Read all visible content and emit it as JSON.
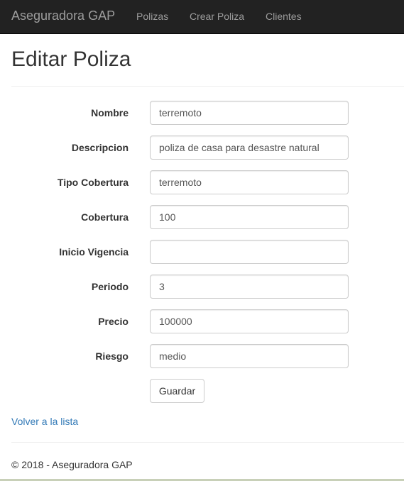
{
  "navbar": {
    "brand": "Aseguradora GAP",
    "links": [
      "Polizas",
      "Crear Poliza",
      "Clientes"
    ]
  },
  "page": {
    "title": "Editar Poliza"
  },
  "form": {
    "fields": [
      {
        "label": "Nombre",
        "value": "terremoto",
        "placeholder": ""
      },
      {
        "label": "Descripcion",
        "value": "poliza de casa para desastre natural",
        "placeholder": ""
      },
      {
        "label": "Tipo Cobertura",
        "value": "terremoto",
        "placeholder": ""
      },
      {
        "label": "Cobertura",
        "value": "100",
        "placeholder": ""
      },
      {
        "label": "Inicio Vigencia",
        "value": "",
        "placeholder": ""
      },
      {
        "label": "Periodo",
        "value": "3",
        "placeholder": ""
      },
      {
        "label": "Precio",
        "value": "100000",
        "placeholder": ""
      },
      {
        "label": "Riesgo",
        "value": "medio",
        "placeholder": ""
      }
    ],
    "submit_label": "Guardar"
  },
  "back_link": "Volver a la lista",
  "footer": {
    "text": "© 2018 - Aseguradora GAP"
  },
  "colors": {
    "navbar_bg": "#222222",
    "nav_text": "#9d9d9d",
    "link": "#337ab7"
  }
}
